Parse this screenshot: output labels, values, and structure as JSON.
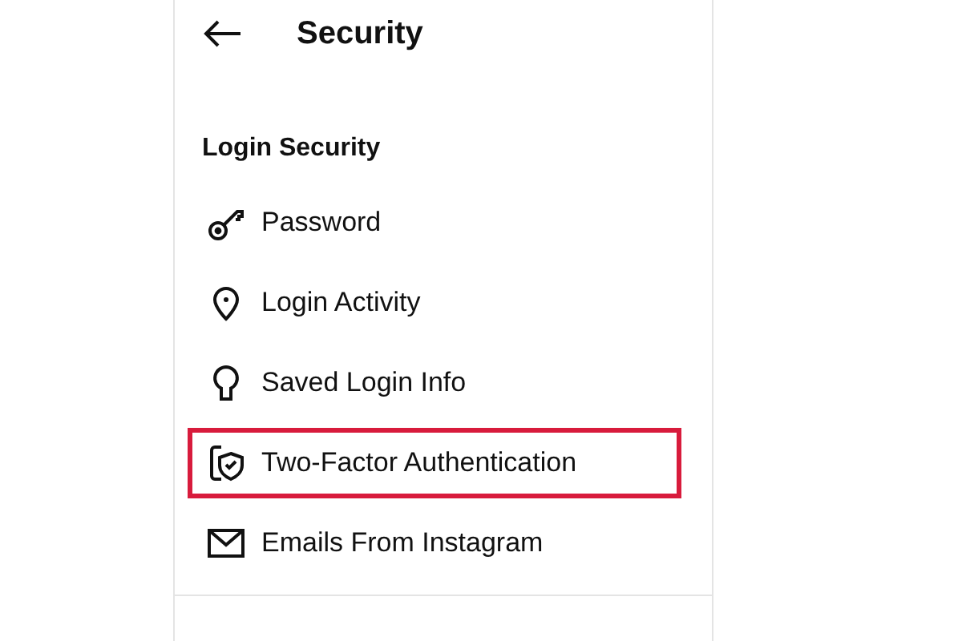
{
  "header": {
    "title": "Security"
  },
  "section": {
    "heading": "Login Security"
  },
  "items": [
    {
      "kind": "key",
      "label": "Password",
      "highlighted": false
    },
    {
      "kind": "pin",
      "label": "Login Activity",
      "highlighted": false
    },
    {
      "kind": "keyhole",
      "label": "Saved Login Info",
      "highlighted": false
    },
    {
      "kind": "shield",
      "label": "Two-Factor Authentication",
      "highlighted": true
    },
    {
      "kind": "mail",
      "label": "Emails From Instagram",
      "highlighted": false
    }
  ]
}
